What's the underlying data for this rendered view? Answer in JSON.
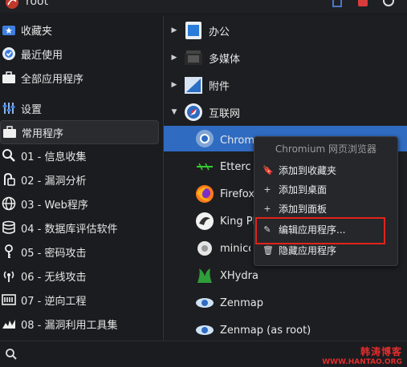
{
  "top": {
    "user": "root"
  },
  "left_menu": [
    {
      "label": "收藏夹",
      "icon": "star-folder-icon"
    },
    {
      "label": "最近使用",
      "icon": "recent-icon"
    },
    {
      "label": "全部应用程序",
      "icon": "all-apps-icon"
    },
    {
      "label": "设置",
      "icon": "settings-icon"
    },
    {
      "label": "常用程序",
      "icon": "common-apps-icon",
      "selected": true
    },
    {
      "label": "01 - 信息收集",
      "icon": "magnifier-icon"
    },
    {
      "label": "02 - 漏洞分析",
      "icon": "vuln-analysis-icon"
    },
    {
      "label": "03 - Web程序",
      "icon": "globe-icon"
    },
    {
      "label": "04 - 数据库评估软件",
      "icon": "database-icon"
    },
    {
      "label": "05 - 密码攻击",
      "icon": "key-icon"
    },
    {
      "label": "06 - 无线攻击",
      "icon": "wireless-icon"
    },
    {
      "label": "07 - 逆向工程",
      "icon": "reverse-icon"
    },
    {
      "label": "08 - 漏洞利用工具集",
      "icon": "exploit-icon"
    }
  ],
  "right_list": [
    {
      "label": "办公",
      "icon": "office-icon",
      "expandable": true
    },
    {
      "label": "多媒体",
      "icon": "multimedia-icon",
      "expandable": true
    },
    {
      "label": "附件",
      "icon": "accessories-icon",
      "expandable": true
    },
    {
      "label": "互联网",
      "icon": "internet-icon",
      "expanded": true
    },
    {
      "label": "Chromium 网页浏览器",
      "icon": "chromium-icon",
      "highlight": true
    },
    {
      "label": "Ettercap",
      "icon": "ettercap-icon"
    },
    {
      "label": "Firefox",
      "icon": "firefox-icon"
    },
    {
      "label": "King Phisher",
      "icon": "king-phisher-icon"
    },
    {
      "label": "minicom",
      "icon": "minicom-icon"
    },
    {
      "label": "XHydra",
      "icon": "xhydra-icon"
    },
    {
      "label": "Zenmap",
      "icon": "zenmap-icon"
    },
    {
      "label": "Zenmap (as root)",
      "icon": "zenmap-root-icon"
    }
  ],
  "context_menu": {
    "title": "Chromium 网页浏览器",
    "items": [
      {
        "label": "添加到收藏夹",
        "icon": "bookmark-icon"
      },
      {
        "label": "添加到桌面",
        "icon": "plus-icon"
      },
      {
        "label": "添加到面板",
        "icon": "plus-icon"
      },
      {
        "label": "编辑应用程序...",
        "icon": "pencil-icon"
      },
      {
        "label": "隐藏应用程序",
        "icon": "trash-icon"
      }
    ]
  },
  "watermark": {
    "line1": "韩涛博客",
    "line2": "WWW.HANTAO.ORG"
  },
  "colors": {
    "highlight": "#2f6bc1",
    "redbox": "#e0241b"
  }
}
